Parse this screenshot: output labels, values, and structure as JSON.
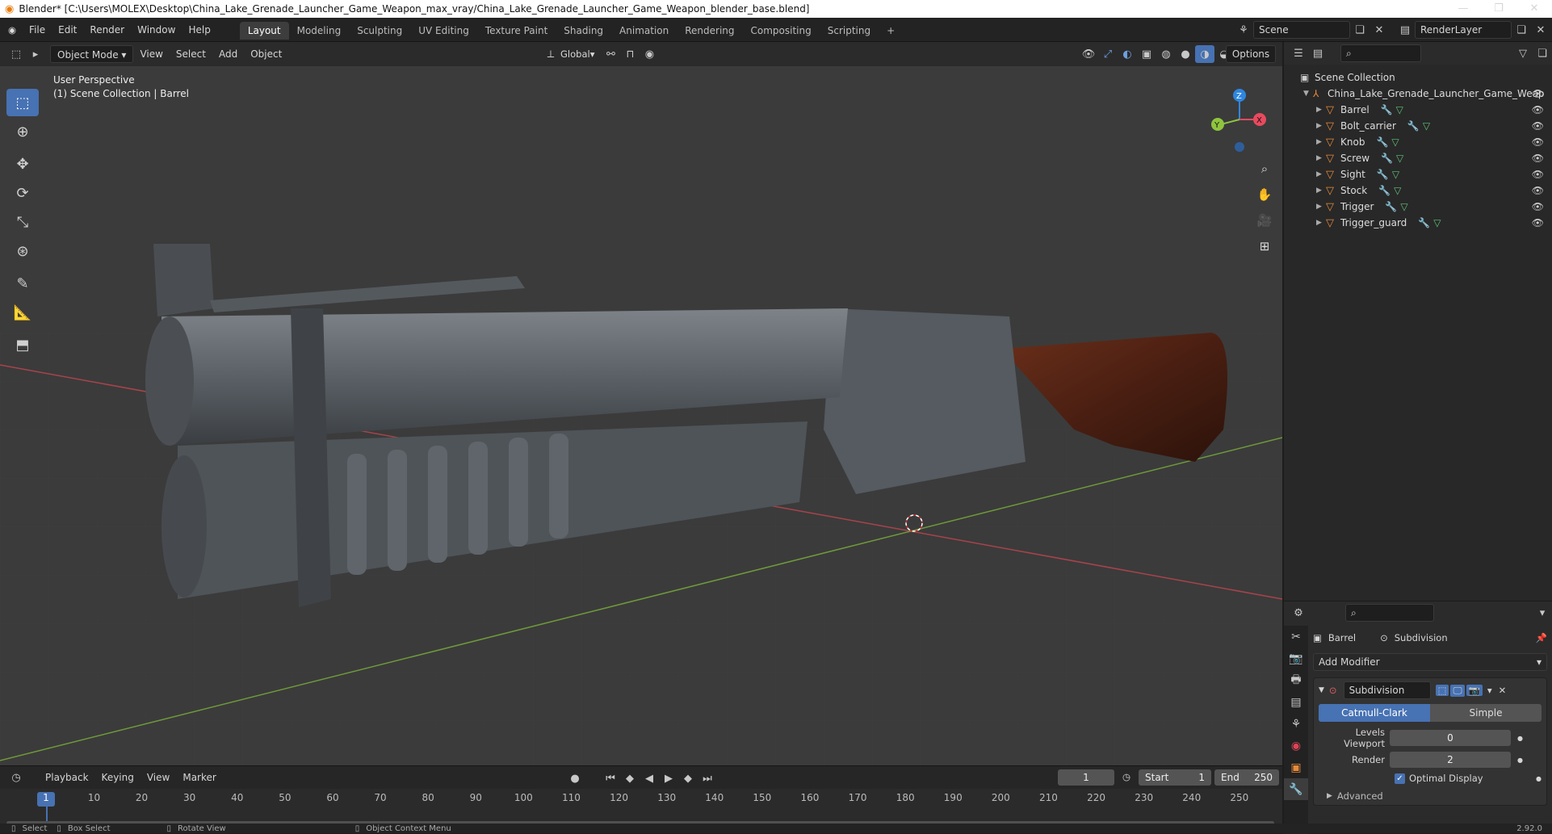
{
  "titlebar": {
    "title": "Blender* [C:\\Users\\MOLEX\\Desktop\\China_Lake_Grenade_Launcher_Game_Weapon_max_vray/China_Lake_Grenade_Launcher_Game_Weapon_blender_base.blend]",
    "min": "—",
    "max": "❐",
    "close": "✕"
  },
  "menus": [
    "File",
    "Edit",
    "Render",
    "Window",
    "Help"
  ],
  "workspaces": [
    "Layout",
    "Modeling",
    "Sculpting",
    "UV Editing",
    "Texture Paint",
    "Shading",
    "Animation",
    "Rendering",
    "Compositing",
    "Scripting"
  ],
  "active_workspace": 0,
  "workspace_add": "+",
  "scene": {
    "label": "Scene",
    "layer": "RenderLayer"
  },
  "viewport": {
    "mode": "Object Mode",
    "menus": [
      "View",
      "Select",
      "Add",
      "Object"
    ],
    "transform": "Global",
    "options": "Options",
    "info_line1": "User Perspective",
    "info_line2": "(1) Scene Collection | Barrel",
    "gizmo": {
      "x": "X",
      "y": "Y",
      "z": "Z"
    }
  },
  "outliner": {
    "root": "Scene Collection",
    "collection": "China_Lake_Grenade_Launcher_Game_Weap",
    "objects": [
      "Barrel",
      "Bolt_carrier",
      "Knob",
      "Screw",
      "Sight",
      "Stock",
      "Trigger",
      "Trigger_guard"
    ]
  },
  "properties": {
    "object": "Barrel",
    "modifier_breadcrumb": "Subdivision",
    "add_modifier": "Add Modifier",
    "modifier_name": "Subdivision",
    "type_a": "Catmull-Clark",
    "type_b": "Simple",
    "levels_viewport_label": "Levels Viewport",
    "levels_viewport": "0",
    "render_label": "Render",
    "render": "2",
    "optimal_display": "Optimal Display",
    "advanced": "Advanced"
  },
  "timeline": {
    "menus": [
      "Playback",
      "Keying",
      "View",
      "Marker"
    ],
    "current_frame": "1",
    "start_label": "Start",
    "start": "1",
    "end_label": "End",
    "end": "250",
    "ticks": [
      "1",
      "10",
      "20",
      "30",
      "40",
      "50",
      "60",
      "70",
      "80",
      "90",
      "100",
      "110",
      "120",
      "130",
      "140",
      "150",
      "160",
      "170",
      "180",
      "190",
      "200",
      "210",
      "220",
      "230",
      "240",
      "250"
    ]
  },
  "statusbar": {
    "select": "Select",
    "box_select": "Box Select",
    "rotate_view": "Rotate View",
    "context_menu": "Object Context Menu",
    "version": "2.92.0"
  },
  "colors": {
    "accent": "#4772b3",
    "mesh": "#e88a3a",
    "axis_x": "#e84a5f",
    "axis_y": "#8fc53e",
    "axis_z": "#2e86de"
  }
}
